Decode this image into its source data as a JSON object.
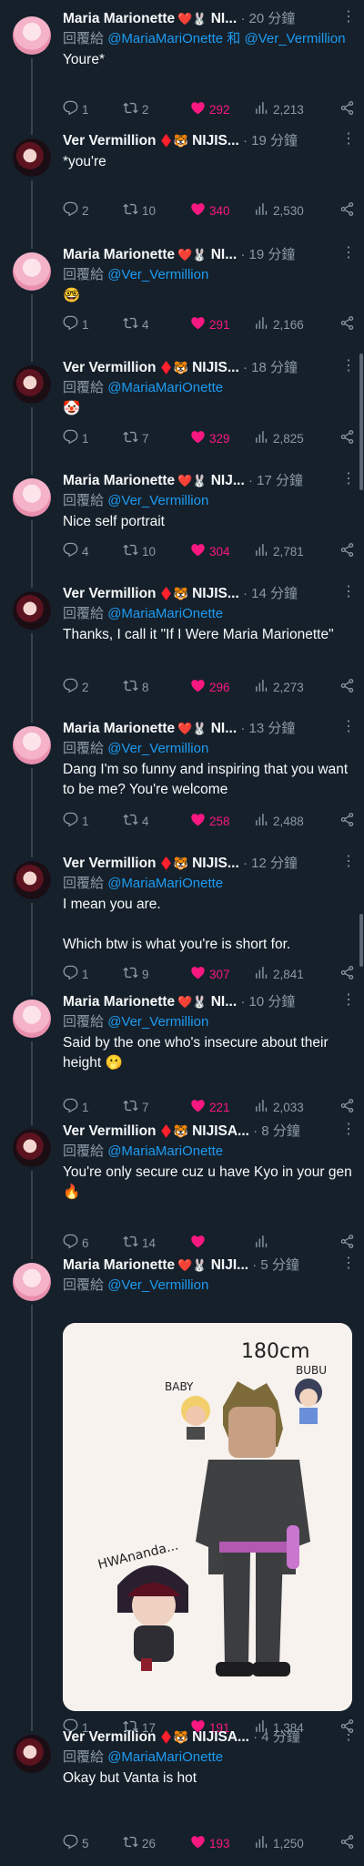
{
  "reply_prefix": "回覆給",
  "tweets": [
    {
      "author": "Maria Marionette",
      "badges": "❤️🐰",
      "name_tail": "NI...",
      "time": "· 20 分鐘",
      "reply_to": "@MariaMariOnette 和 @Ver_Vermillion",
      "text": [
        "Youre*"
      ],
      "replies": "1",
      "retweets": "2",
      "likes": "292",
      "views": "2,213"
    },
    {
      "author": "Ver Vermillion",
      "badges": "♦️🐯",
      "name_tail": "NIJIS...",
      "time": "· 19 分鐘",
      "reply_to": "",
      "text": [
        "*you're"
      ],
      "replies": "2",
      "retweets": "10",
      "likes": "340",
      "views": "2,530"
    },
    {
      "author": "Maria Marionette",
      "badges": "❤️🐰",
      "name_tail": "NI...",
      "time": "· 19 分鐘",
      "reply_to": "@Ver_Vermillion",
      "text": [
        "🤓"
      ],
      "replies": "1",
      "retweets": "4",
      "likes": "291",
      "views": "2,166"
    },
    {
      "author": "Ver Vermillion",
      "badges": "♦️🐯",
      "name_tail": "NIJIS...",
      "time": "· 18 分鐘",
      "reply_to": "@MariaMariOnette",
      "text": [
        "🤡"
      ],
      "replies": "1",
      "retweets": "7",
      "likes": "329",
      "views": "2,825"
    },
    {
      "author": "Maria Marionette",
      "badges": "❤️🐰",
      "name_tail": "NIJ...",
      "time": "· 17 分鐘",
      "reply_to": "@Ver_Vermillion",
      "text": [
        "Nice self portrait"
      ],
      "replies": "4",
      "retweets": "10",
      "likes": "304",
      "views": "2,781"
    },
    {
      "author": "Ver Vermillion",
      "badges": "♦️🐯",
      "name_tail": "NIJIS...",
      "time": "· 14 分鐘",
      "reply_to": "@MariaMariOnette",
      "text": [
        "Thanks, I call it \"If I Were Maria Marionette\""
      ],
      "replies": "2",
      "retweets": "8",
      "likes": "296",
      "views": "2,273"
    },
    {
      "author": "Maria Marionette",
      "badges": "❤️🐰",
      "name_tail": "NI...",
      "time": "· 13 分鐘",
      "reply_to": "@Ver_Vermillion",
      "text": [
        "Dang I'm so funny and inspiring that you want to be me? You're welcome"
      ],
      "replies": "1",
      "retweets": "4",
      "likes": "258",
      "views": "2,488"
    },
    {
      "author": "Ver Vermillion",
      "badges": "♦️🐯",
      "name_tail": "NIJIS...",
      "time": "· 12 分鐘",
      "reply_to": "@MariaMariOnette",
      "text": [
        "I mean you are.",
        "Which btw is what you're is short for."
      ],
      "replies": "1",
      "retweets": "9",
      "likes": "307",
      "views": "2,841"
    },
    {
      "author": "Maria Marionette",
      "badges": "❤️🐰",
      "name_tail": "NI...",
      "time": "· 10 分鐘",
      "reply_to": "@Ver_Vermillion",
      "text": [
        "Said by the one who's insecure about their height 🫢"
      ],
      "replies": "1",
      "retweets": "7",
      "likes": "221",
      "views": "2,033"
    },
    {
      "author": "Ver Vermillion",
      "badges": "♦️🐯",
      "name_tail": "NIJISA...",
      "time": "· 8 分鐘",
      "reply_to": "@MariaMariOnette",
      "text": [
        "You're only secure cuz u have Kyo in your gen 🔥"
      ],
      "replies": "6",
      "retweets": "14",
      "likes": "",
      "views": ""
    },
    {
      "author": "Maria Marionette",
      "badges": "❤️🐰",
      "name_tail": "NIJI...",
      "time": "· 5 分鐘",
      "reply_to": "@Ver_Vermillion",
      "text": [],
      "replies": "1",
      "retweets": "17",
      "likes": "191",
      "views": "1,384",
      "image": {
        "height_label": "180cm",
        "label_baby": "BABY",
        "label_bubu": "BUBU",
        "caption": "HWAnanda..."
      }
    },
    {
      "author": "Ver Vermillion",
      "badges": "♦️🐯",
      "name_tail": "NIJISA...",
      "time": "· 4 分鐘",
      "reply_to": "@MariaMariOnette",
      "text": [
        "Okay but Vanta is hot"
      ],
      "replies": "5",
      "retweets": "26",
      "likes": "193",
      "views": "1,250"
    }
  ],
  "colors": {
    "background": "#15202b",
    "text": "#f7f9f9",
    "muted": "#8b98a5",
    "link": "#1d9bf0",
    "like": "#f91880"
  },
  "icons": {
    "reply": "reply-icon",
    "retweet": "retweet-icon",
    "like": "heart-icon",
    "views": "views-icon",
    "share": "share-icon",
    "more": "more-icon"
  }
}
